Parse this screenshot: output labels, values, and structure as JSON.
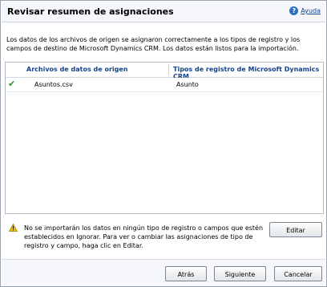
{
  "dialog": {
    "title": "Revisar resumen de asignaciones",
    "help_label": "Ayuda",
    "description": "Los datos de los archivos de origen se asignaron correctamente a los tipos de registro y los campos de destino de Microsoft Dynamics CRM. Los datos están listos para la importación."
  },
  "grid": {
    "columns": [
      "Archivos de datos de origen",
      "Tipos de registro de Microsoft Dynamics CRM"
    ],
    "rows": [
      {
        "status": "check",
        "source": "Asuntos.csv",
        "target": "Asunto"
      }
    ]
  },
  "warning": {
    "icon": "warning-icon",
    "text": "No se importarán los datos en ningún tipo de registro o campos que estén establecidos en Ignorar. Para ver o cambiar las asignaciones de tipo de registro y campo, haga clic en Editar."
  },
  "buttons": {
    "edit": "Editar",
    "back": "Atrás",
    "next": "Siguiente",
    "cancel": "Cancelar"
  },
  "colors": {
    "link_blue": "#15428b",
    "check_green": "#2e8b2e",
    "warning_yellow": "#f2c200"
  }
}
